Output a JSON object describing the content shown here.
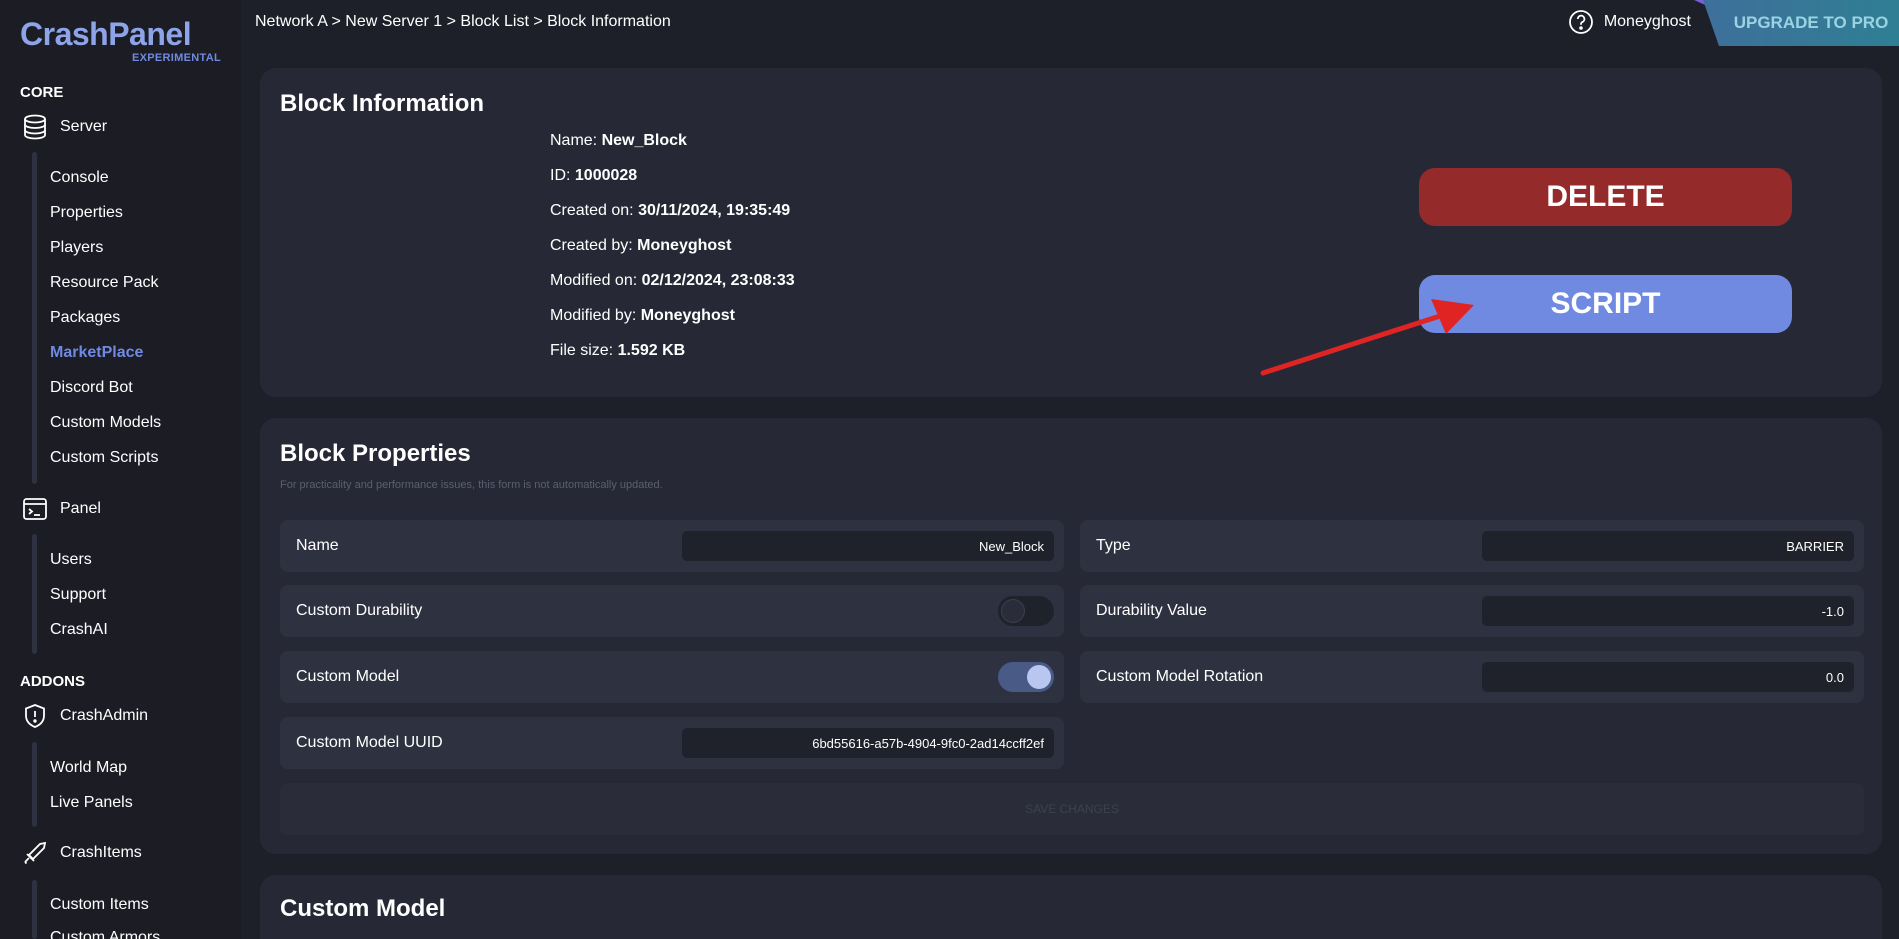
{
  "brand": {
    "name": "CrashPanel",
    "tag": "EXPERIMENTAL"
  },
  "sidebar": {
    "core_title": "CORE",
    "server": {
      "label": "Server",
      "items": [
        "Console",
        "Properties",
        "Players",
        "Resource Pack",
        "Packages",
        "MarketPlace",
        "Discord Bot",
        "Custom Models",
        "Custom Scripts"
      ],
      "active": "MarketPlace"
    },
    "panel": {
      "label": "Panel",
      "items": [
        "Users",
        "Support",
        "CrashAI"
      ]
    },
    "addons_title": "ADDONS",
    "crashadmin": {
      "label": "CrashAdmin",
      "items": [
        "World Map",
        "Live Panels"
      ]
    },
    "crashitems": {
      "label": "CrashItems",
      "items": [
        "Custom Items",
        "Custom Armors"
      ]
    }
  },
  "header": {
    "breadcrumb": "Network A > New Server 1 > Block List > Block Information",
    "username": "Moneyghost",
    "upgrade_label": "UPGRADE TO PRO"
  },
  "block_info": {
    "title": "Block Information",
    "lines": [
      {
        "label": "Name:",
        "value": "New_Block"
      },
      {
        "label": "ID:",
        "value": "1000028"
      },
      {
        "label": "Created on:",
        "value": "30/11/2024, 19:35:49"
      },
      {
        "label": "Created by:",
        "value": "Moneyghost"
      },
      {
        "label": "Modified on:",
        "value": "02/12/2024, 23:08:33"
      },
      {
        "label": "Modified by:",
        "value": "Moneyghost"
      },
      {
        "label": "File size:",
        "value": "1.592 KB"
      }
    ],
    "delete_label": "DELETE",
    "script_label": "SCRIPT"
  },
  "block_properties": {
    "title": "Block Properties",
    "hint": "For practicality and performance issues, this form is not automatically updated.",
    "fields": {
      "name": {
        "label": "Name",
        "value": "New_Block"
      },
      "type": {
        "label": "Type",
        "value": "BARRIER"
      },
      "custom_durability": {
        "label": "Custom Durability",
        "enabled": false
      },
      "durability_value": {
        "label": "Durability Value",
        "value": "-1.0"
      },
      "custom_model": {
        "label": "Custom Model",
        "enabled": true
      },
      "custom_model_rotation": {
        "label": "Custom Model Rotation",
        "value": "0.0"
      },
      "custom_model_uuid": {
        "label": "Custom Model UUID",
        "value": "6bd55616-a57b-4904-9fc0-2ad14ccff2ef"
      }
    },
    "save_label": "SAVE CHANGES"
  },
  "custom_model": {
    "title": "Custom Model"
  },
  "colors": {
    "accent": "#6f8ae0",
    "danger": "#952a2a",
    "annotation_arrow": "#e02424"
  }
}
